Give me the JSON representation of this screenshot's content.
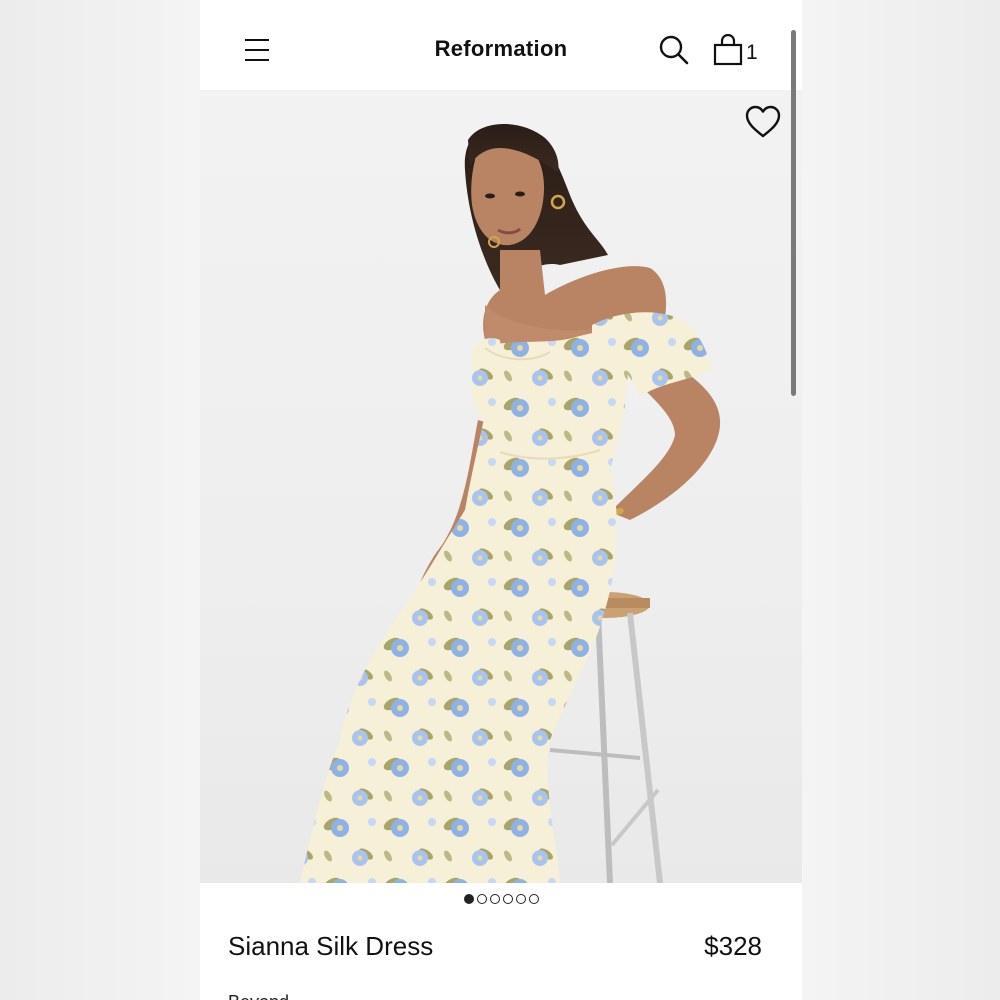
{
  "header": {
    "brand": "Reformation",
    "bag_count": "1"
  },
  "icons": {
    "menu": "hamburger-menu-icon",
    "search": "search-icon",
    "bag": "shopping-bag-icon",
    "wishlist": "heart-icon"
  },
  "gallery": {
    "image_count": 6,
    "active_index": 0
  },
  "product": {
    "name": "Sianna Silk Dress",
    "price": "$328",
    "cutoff_text": "Beyond"
  },
  "colors": {
    "text": "#111111",
    "dress_base": "#f6f0d8",
    "flower_blue": "#8fb2e6",
    "leaf_olive": "#a9a56a",
    "skin": "#b98463",
    "hair": "#2a1d17",
    "stool_wood": "#c9a173",
    "stool_metal": "#bdbdbd"
  }
}
